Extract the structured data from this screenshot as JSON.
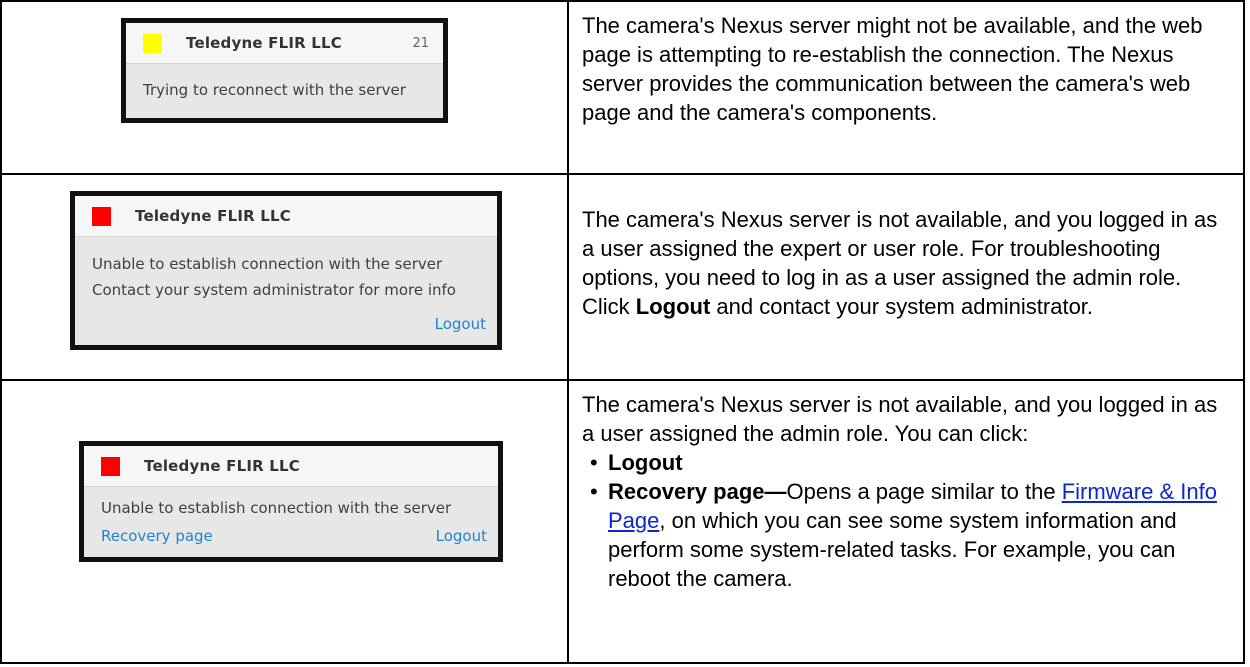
{
  "rows": [
    {
      "dialog": {
        "indicator_color": "#ffff00",
        "title": "Teledyne FLIR LLC",
        "number": "21",
        "lines": [
          "Trying to reconnect with the server"
        ]
      },
      "description": "The camera's Nexus server might not be available, and the web page is attempting to re-establish the connection. The Nexus server provides the communication between the camera's web page and the camera's components."
    },
    {
      "dialog": {
        "indicator_color": "#ff0000",
        "title": "Teledyne FLIR LLC",
        "lines": [
          "Unable to establish connection with the server",
          "Contact your system administrator for more info"
        ],
        "logout_link": "Logout"
      },
      "description_parts": {
        "before": "The camera's Nexus server is not available, and you logged in as a user assigned the expert or user role. For troubleshooting options, you need to log in as a user assigned the admin role. Click ",
        "bold": "Logout",
        "after": " and contact your system administrator."
      }
    },
    {
      "dialog": {
        "indicator_color": "#ff0000",
        "title": "Teledyne FLIR LLC",
        "lines": [
          "Unable to establish connection with the server"
        ],
        "recovery_link": "Recovery page",
        "logout_link": "Logout"
      },
      "description_intro": "The camera's Nexus server is not available, and you logged in as a user assigned the admin role. You can click:",
      "options": [
        {
          "label": "Logout"
        },
        {
          "label": "Recovery page—",
          "text_before": "Opens a page similar to the ",
          "link": "Firmware & Info Page",
          "text_after": ", on which you can see some system information and perform some system-related tasks. For example, you can reboot the camera."
        }
      ]
    }
  ]
}
